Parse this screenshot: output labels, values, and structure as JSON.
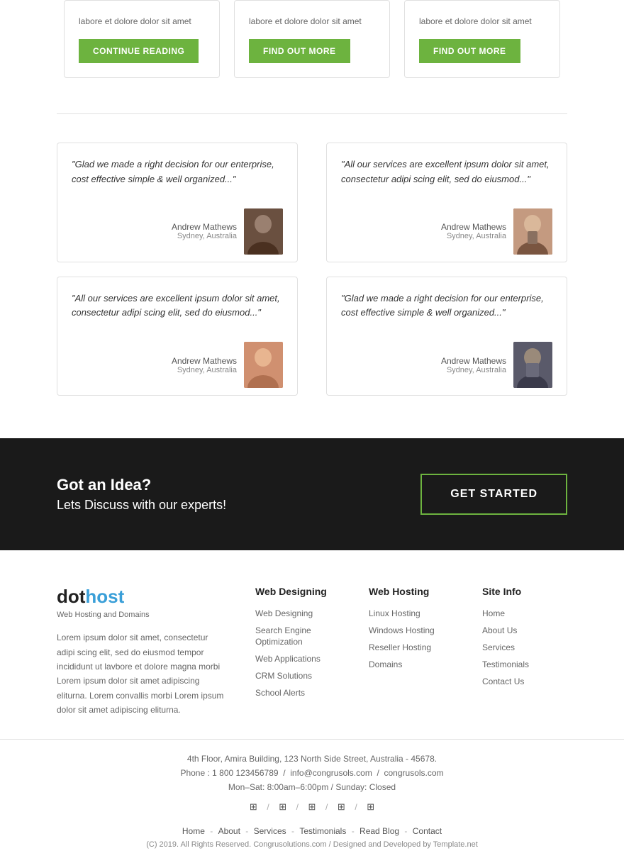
{
  "cards": [
    {
      "text": "labore et dolore dolor sit amet",
      "button": "CONTINUE READING",
      "type": "continue"
    },
    {
      "text": "labore et dolore dolor sit amet",
      "button": "FIND OUT MORE",
      "type": "findout"
    },
    {
      "text": "labore et dolore dolor sit amet",
      "button": "FIND OUT MORE",
      "type": "findout"
    }
  ],
  "testimonials": {
    "left": [
      {
        "text": "\"Glad we made a right decision for our enterprise, cost effective simple & well organized...\"",
        "author": "Andrew Mathews",
        "location": "Sydney, Australia",
        "avatar": "avatar-1"
      },
      {
        "text": "\"All our services are excellent ipsum dolor sit amet, consectetur adipi scing elit, sed do eiusmod...\"",
        "author": "Andrew Mathews",
        "location": "Sydney, Australia",
        "avatar": "avatar-2"
      }
    ],
    "right": [
      {
        "text": "\"All our services are excellent ipsum dolor sit amet, consectetur adipi scing elit, sed do eiusmod...\"",
        "author": "Andrew Mathews",
        "location": "Sydney, Australia",
        "avatar": "avatar-3"
      },
      {
        "text": "\"Glad we made a right decision for our enterprise, cost effective simple & well organized...\"",
        "author": "Andrew Mathews",
        "location": "Sydney, Australia",
        "avatar": "avatar-4"
      }
    ]
  },
  "cta": {
    "heading": "Got an Idea?",
    "subheading": "Lets Discuss with our experts!",
    "button": "GET STARTED"
  },
  "footer": {
    "logo_dot": "dot",
    "logo_host": "host",
    "tagline": "Web Hosting and Domains",
    "description": "Lorem ipsum dolor sit amet, consectetur adipi scing elit, sed do eiusmod tempor incididunt ut lavbore et dolore magna morbi Lorem ipsum dolor sit amet adipiscing eliturna. Lorem convallis morbi Lorem ipsum dolor sit amet adipiscing eliturna.",
    "columns": [
      {
        "heading": "Web Designing",
        "links": [
          "Web Designing",
          "Search Engine Optimization",
          "Web Applications",
          "CRM Solutions",
          "School Alerts"
        ]
      },
      {
        "heading": "Web Hosting",
        "links": [
          "Linux Hosting",
          "Windows Hosting",
          "Reseller Hosting",
          "Domains"
        ]
      },
      {
        "heading": "Site Info",
        "links": [
          "Home",
          "About Us",
          "Services",
          "Testimonials",
          "Contact Us"
        ]
      }
    ],
    "address": "4th Floor, Amira Building, 123 North Side Street, Australia - 45678.",
    "phone": "Phone : 1 800 123456789",
    "email": "info@congrusols.com",
    "website": "congrusols.com",
    "hours": "Mon–Sat: 8:00am–6:00pm  /  Sunday: Closed",
    "social": [
      "f",
      "t",
      "in",
      "P",
      "ig"
    ],
    "nav_links": [
      "Home",
      "About",
      "Services",
      "Testimonials",
      "Read Blog",
      "Contact"
    ],
    "nav_separators": [
      "-",
      "-",
      "-",
      "-",
      "-"
    ],
    "copyright": "(C) 2019. All Rights Reserved. Congrusolutions.com   /   Designed and Developed by Template.net"
  }
}
